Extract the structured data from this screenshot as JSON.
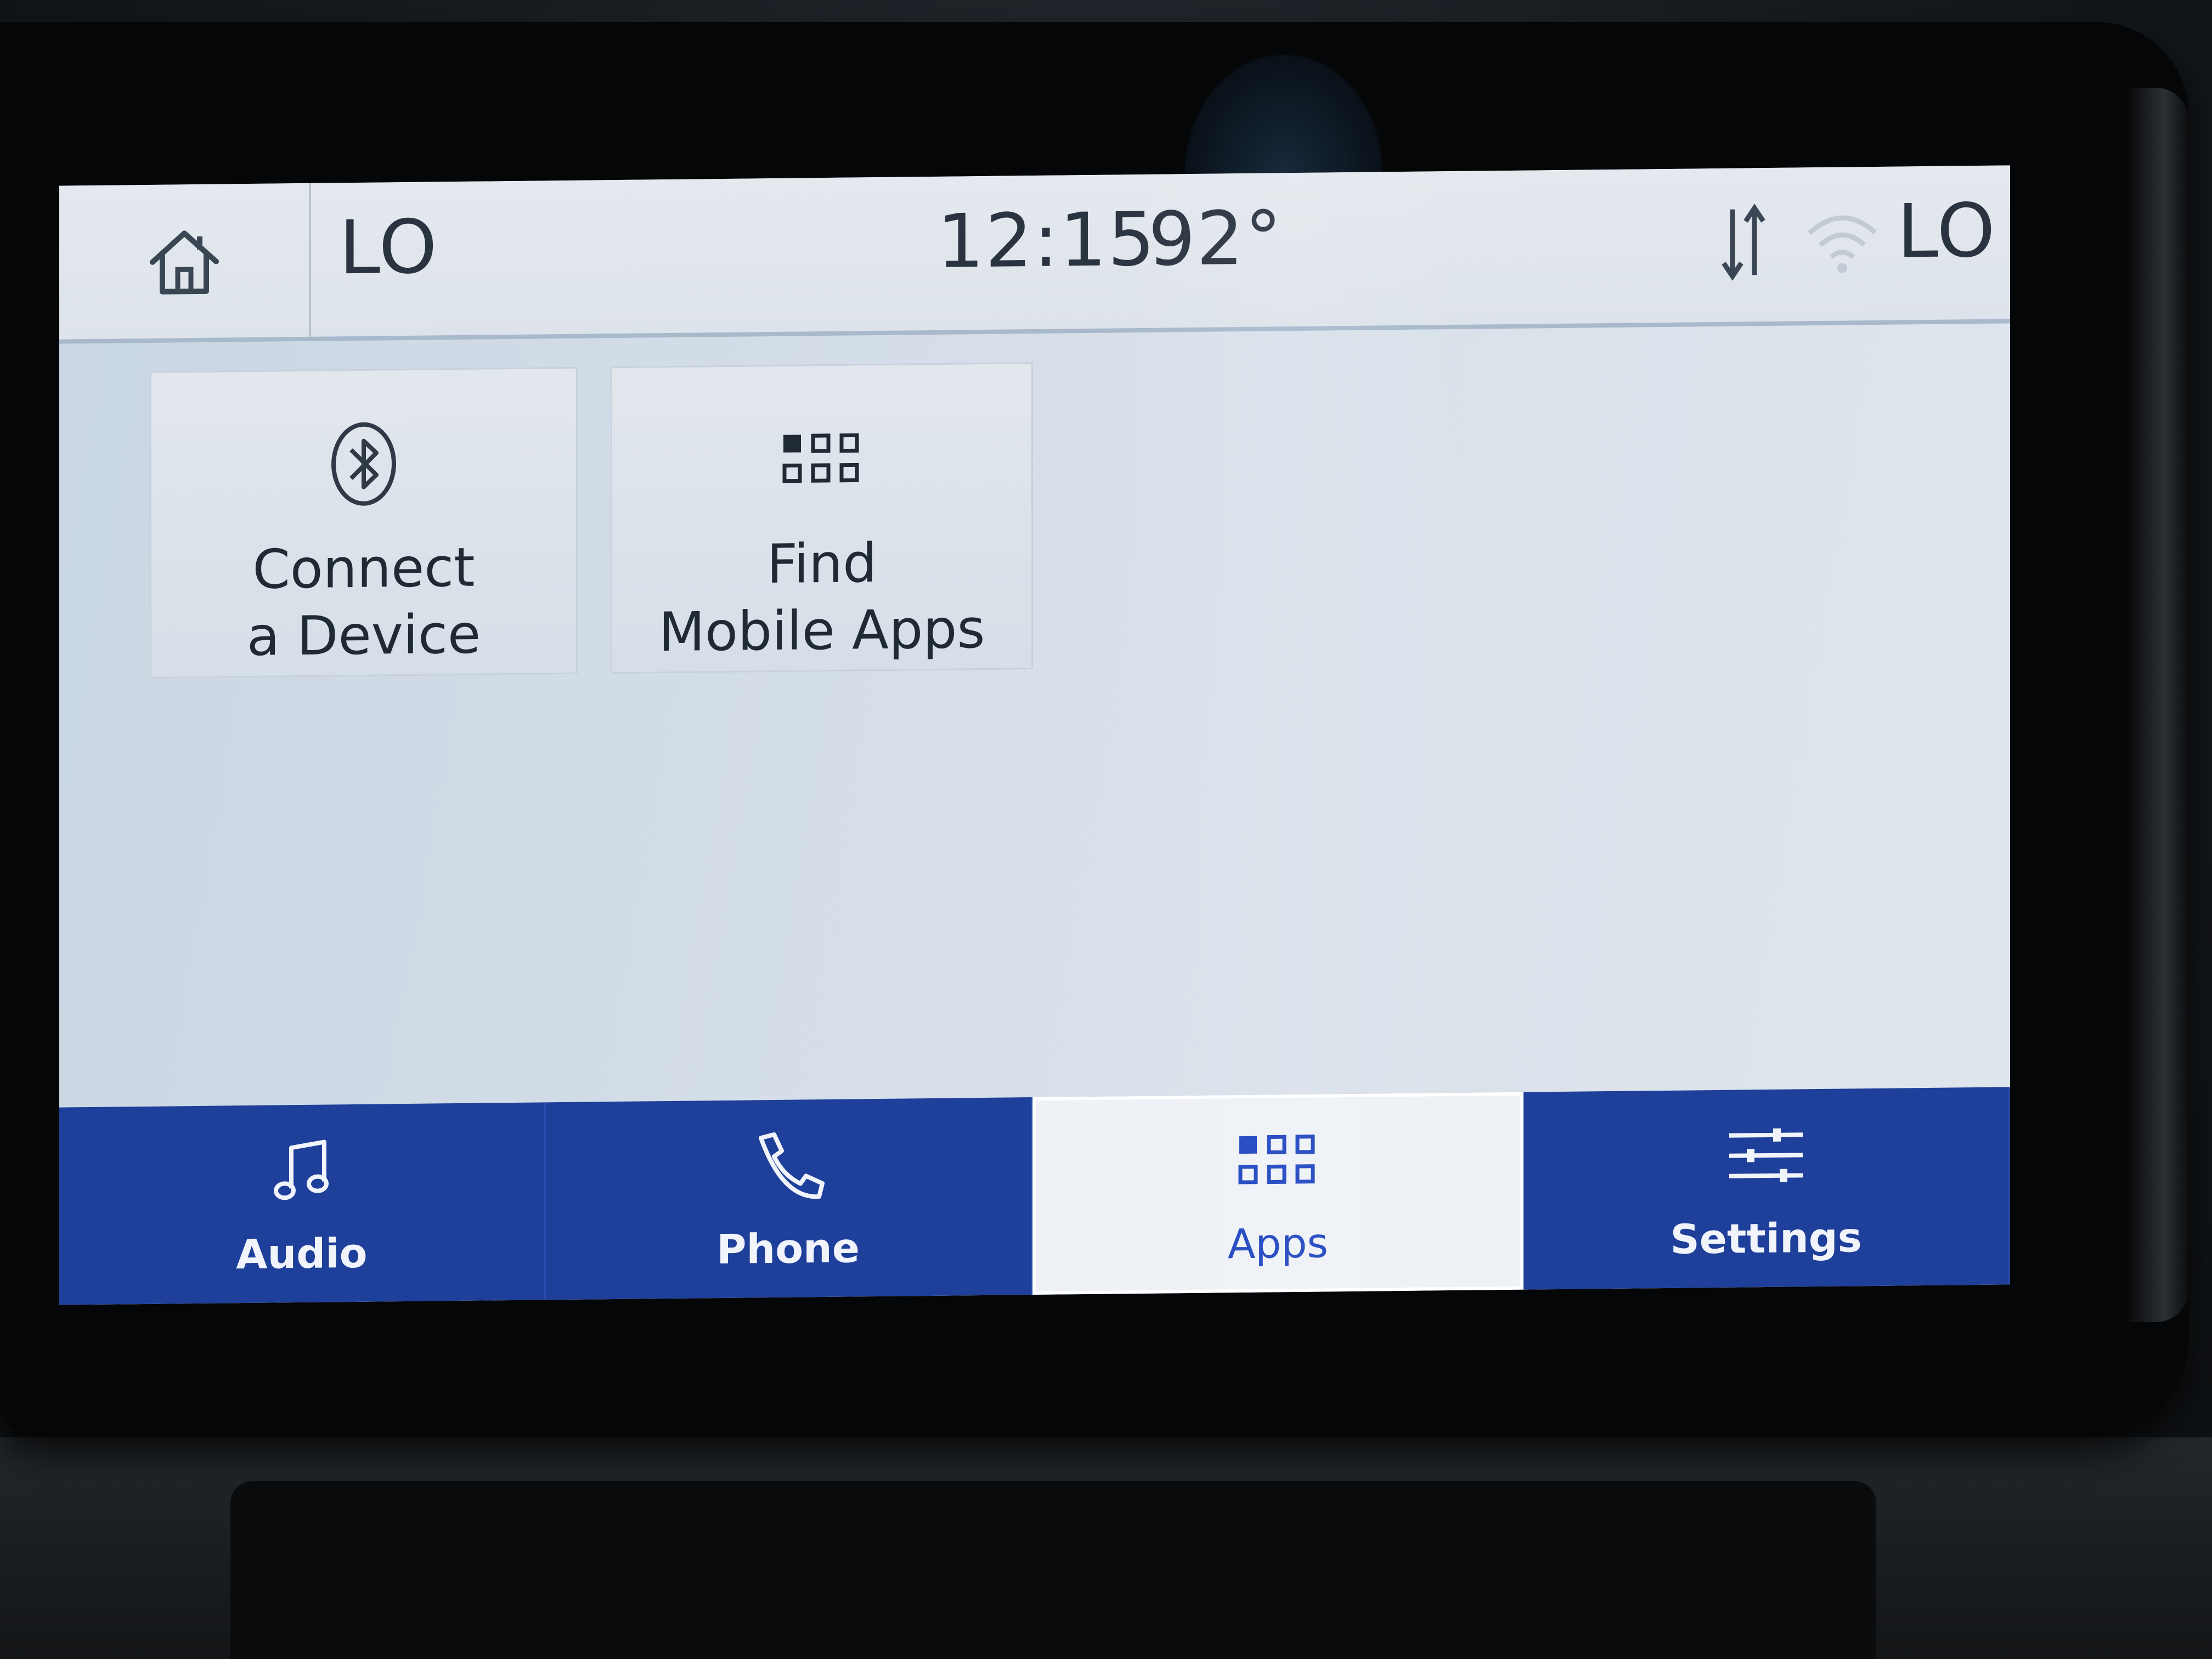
{
  "status_bar": {
    "climate_left": "LO",
    "time": "12:15",
    "temperature": "92°",
    "climate_right": "LO"
  },
  "tiles": [
    {
      "label": "Connect\na Device",
      "icon": "bluetooth-icon"
    },
    {
      "label": "Find\nMobile Apps",
      "icon": "apps-grid-icon"
    }
  ],
  "nav": {
    "items": [
      {
        "label": "Audio",
        "icon": "music-note-icon"
      },
      {
        "label": "Phone",
        "icon": "phone-icon"
      },
      {
        "label": "Apps",
        "icon": "apps-grid-icon",
        "active": true
      },
      {
        "label": "Settings",
        "icon": "sliders-icon"
      }
    ]
  },
  "colors": {
    "nav_bar": "#1e3f9a",
    "active_accent": "#1d44c0",
    "screen_bg": "#d6dfe9"
  }
}
